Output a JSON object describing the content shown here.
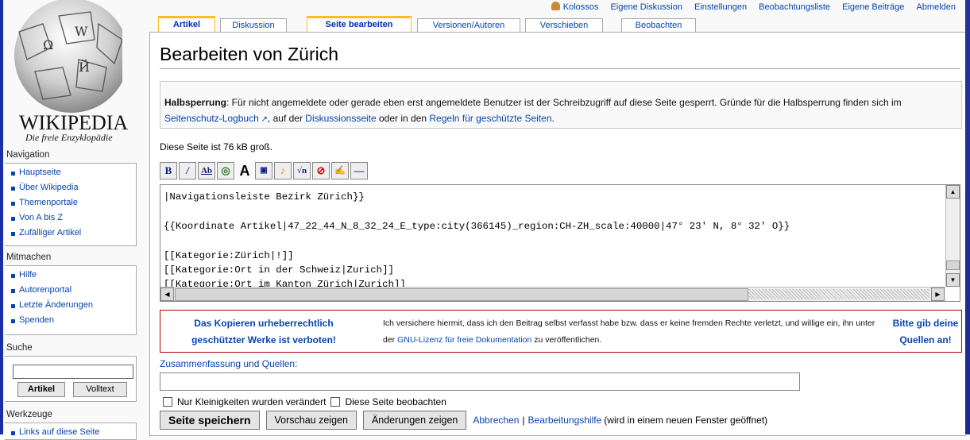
{
  "logo": {
    "wordmark": "WIKIPEDIA",
    "tagline": "Die freie Enzyklopädie"
  },
  "personal": {
    "user": "Kolossos",
    "links": [
      "Eigene Diskussion",
      "Einstellungen",
      "Beobachtungsliste",
      "Eigene Beiträge",
      "Abmelden"
    ]
  },
  "tabs": [
    "Artikel",
    "Diskussion",
    "Seite bearbeiten",
    "Versionen/Autoren",
    "Verschieben",
    "Beobachten"
  ],
  "sidebar": {
    "navigation_title": "Navigation",
    "navigation": [
      "Hauptseite",
      "Über Wikipedia",
      "Themenportale",
      "Von A bis Z",
      "Zufälliger Artikel"
    ],
    "participate_title": "Mitmachen",
    "participate": [
      "Hilfe",
      "Autorenportal",
      "Letzte Änderungen",
      "Spenden"
    ],
    "search_title": "Suche",
    "search_article": "Artikel",
    "search_fulltext": "Volltext",
    "tools_title": "Werkzeuge",
    "tools": [
      "Links auf diese Seite"
    ]
  },
  "page": {
    "title": "Bearbeiten von Zürich",
    "notice_bold": "Halbsperrung",
    "notice_text1": ": Für nicht angemeldete oder gerade eben erst angemeldete Benutzer ist der Schreibzugriff auf diese Seite gesperrt. Gründe für die Halbsperrung finden sich im ",
    "notice_link1": "Seitenschutz-Logbuch",
    "notice_text2": ", auf der ",
    "notice_link2": "Diskussionsseite",
    "notice_text3": " oder in den ",
    "notice_link3": "Regeln für geschützte Seiten",
    "notice_text4": ".",
    "size": "Diese Seite ist 76 kB groß."
  },
  "toolbar_icons": [
    "bold-icon",
    "italic-icon",
    "internal-link-icon",
    "external-link-icon",
    "headline-icon",
    "image-icon",
    "media-icon",
    "math-icon",
    "nowiki-icon",
    "signature-icon",
    "hr-icon"
  ],
  "editor": {
    "lines": [
      "|Navigationsleiste Bezirk Zürich}}",
      "",
      "{{Koordinate Artikel|47_22_44_N_8_32_24_E_type:city(366145)_region:CH-ZH_scale:40000|47° 23' N, 8° 32' O}}",
      "",
      "[[Kategorie:Zürich|!]]",
      "[[Kategorie:Ort in der Schweiz|Zurich]]",
      "[[Kategorie:Ort im Kanton Zürich|Zurich]]"
    ]
  },
  "warning": {
    "left": "Das Kopieren urheberrechtlich geschützter Werke ist verboten!",
    "mid1": "Ich versichere hiermit, dass ich den Beitrag selbst verfasst habe bzw. dass er keine fremden Rechte verletzt, und willige ein, ihn unter der ",
    "mid_link": "GNU-Lizenz für freie Dokumentation",
    "mid2": " zu veröffentlichen.",
    "right": "Bitte gib deine Quellen an!"
  },
  "summary_label": "Zusammenfassung und Quellen:",
  "summary_value": "",
  "checks": [
    "Nur Kleinigkeiten wurden verändert",
    "Diese Seite beobachten"
  ],
  "buttons": {
    "save": "Seite speichern",
    "preview": "Vorschau zeigen",
    "diff": "Änderungen zeigen",
    "cancel": "Abbrechen",
    "sep": "|",
    "help": "Bearbeitungshilfe",
    "help_note": "(wird in einem neuen Fenster geöffnet)"
  },
  "colors": {
    "frame": "#1c2ea6",
    "link": "#0645ad",
    "selected_tab": "#fabd23",
    "warning_border": "#ba0000"
  }
}
